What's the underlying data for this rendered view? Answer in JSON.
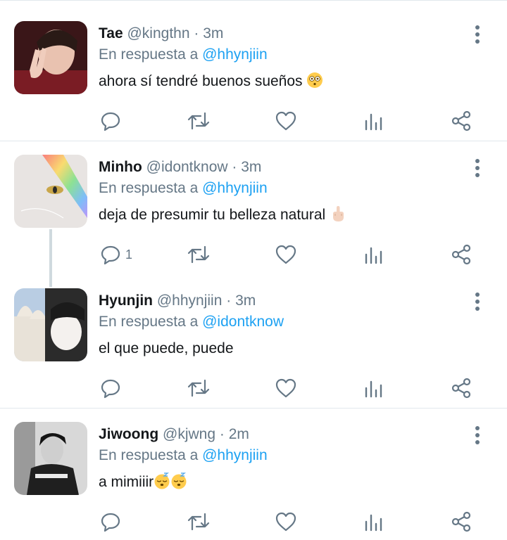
{
  "colors": {
    "accent": "#1da1f2",
    "muted": "#657786",
    "text": "#14171a",
    "divider": "#e1e8ed"
  },
  "tweets": [
    {
      "name": "Tae",
      "handle": "@kingthn",
      "dot": "·",
      "time": "3m",
      "reply_prefix": "En respuesta a",
      "reply_to": "@hhynjiin",
      "text": "ahora sí tendré buenos sueños",
      "emoji": [
        "flushed-face-icon"
      ],
      "reply_count": ""
    },
    {
      "name": "Minho",
      "handle": "@idontknow",
      "dot": "·",
      "time": "3m",
      "reply_prefix": "En respuesta a",
      "reply_to": "@hhynjiin",
      "text": "deja de presumir tu belleza natural",
      "emoji": [
        "middle-finger-icon"
      ],
      "reply_count": "1"
    },
    {
      "name": "Hyunjin",
      "handle": "@hhynjiin",
      "dot": "·",
      "time": "3m",
      "reply_prefix": "En respuesta a",
      "reply_to": "@idontknow",
      "text": "el que puede, puede",
      "emoji": [],
      "reply_count": ""
    },
    {
      "name": "Jiwoong",
      "handle": "@kjwng",
      "dot": "·",
      "time": "2m",
      "reply_prefix": "En respuesta a",
      "reply_to": "@hhynjiin",
      "text": "a mimiiir",
      "emoji": [
        "sleeping-face-icon",
        "sleeping-face-icon"
      ],
      "reply_count": ""
    }
  ],
  "action_icons": [
    "reply-icon",
    "retweet-icon",
    "like-icon",
    "analytics-icon",
    "share-icon"
  ]
}
